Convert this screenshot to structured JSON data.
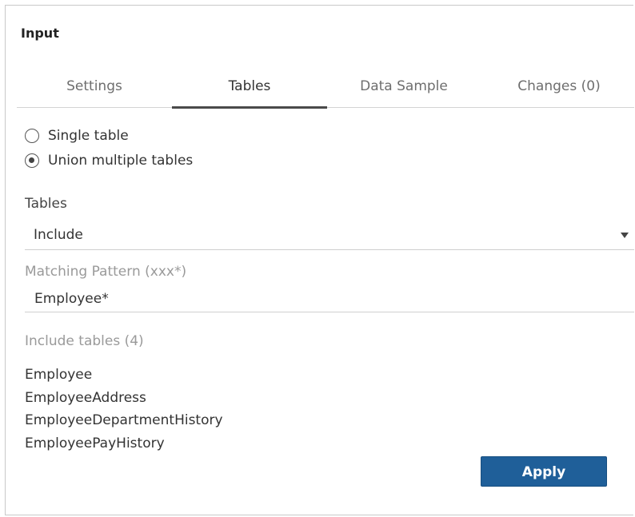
{
  "panel": {
    "title": "Input"
  },
  "tabs": [
    {
      "label": "Settings",
      "active": false
    },
    {
      "label": "Tables",
      "active": true
    },
    {
      "label": "Data Sample",
      "active": false
    },
    {
      "label": "Changes (0)",
      "active": false
    }
  ],
  "table_mode": {
    "options": [
      {
        "label": "Single table",
        "checked": false
      },
      {
        "label": "Union multiple tables",
        "checked": true
      }
    ]
  },
  "tables_filter": {
    "label": "Tables",
    "selected": "Include"
  },
  "matching_pattern": {
    "label": "Matching Pattern (xxx*)",
    "value": "Employee*"
  },
  "include_tables": {
    "label": "Include tables (4)",
    "items": [
      "Employee",
      "EmployeeAddress",
      "EmployeeDepartmentHistory",
      "EmployeePayHistory"
    ]
  },
  "actions": {
    "apply_label": "Apply"
  },
  "colors": {
    "accent": "#1f5f99",
    "muted_text": "#9a9a9a",
    "active_tab_underline": "#4a4a4a"
  }
}
